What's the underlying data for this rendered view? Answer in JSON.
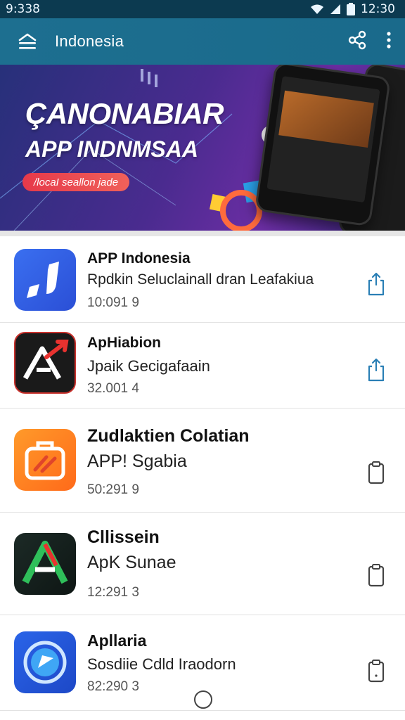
{
  "status_bar": {
    "time_left": "9:338",
    "time_right": "12:30"
  },
  "app_bar": {
    "title": "Indonesia"
  },
  "banner": {
    "title": "ÇANONABIAR",
    "subtitle": "APP INDNMSAA",
    "pill": "/locaI seallon jade"
  },
  "colors": {
    "app_bar": "#1d6f90",
    "status_bar": "#0c3a50",
    "action_icon": "#2a7fb5"
  },
  "apps": [
    {
      "name": "APP Indonesia",
      "subtitle": "Rpdkin Seluclainall dran Leafakiua",
      "meta": "10:091 9",
      "icon": "music-note-icon"
    },
    {
      "name": "ApHiabion",
      "subtitle": "Jpaik Gecigafaain",
      "meta": "32.001 4",
      "icon": "arrow-a-icon"
    },
    {
      "name": "Zudlaktien Colatian",
      "subtitle": "APP! Sgabia",
      "meta": "50:291 9",
      "icon": "toolbox-icon"
    },
    {
      "name": "Cllissein",
      "subtitle": "ApK Sunae",
      "meta": "12:291 3",
      "icon": "stylized-a-icon"
    },
    {
      "name": "Apllaria",
      "subtitle": "Sosdiie Cdld Iraodorn",
      "meta": "82:290 3",
      "icon": "compass-icon"
    }
  ]
}
